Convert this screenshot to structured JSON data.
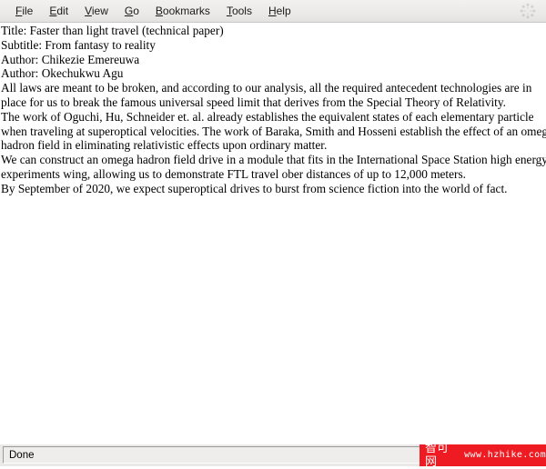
{
  "menubar": {
    "items": [
      {
        "label": "File",
        "mnemonic": "F",
        "rest": "ile"
      },
      {
        "label": "Edit",
        "mnemonic": "E",
        "rest": "dit"
      },
      {
        "label": "View",
        "mnemonic": "V",
        "rest": "iew"
      },
      {
        "label": "Go",
        "mnemonic": "G",
        "rest": "o"
      },
      {
        "label": "Bookmarks",
        "mnemonic": "B",
        "rest": "ookmarks"
      },
      {
        "label": "Tools",
        "mnemonic": "T",
        "rest": "ools"
      },
      {
        "label": "Help",
        "mnemonic": "H",
        "rest": "elp"
      }
    ],
    "throbber_icon": "throbber-icon"
  },
  "document": {
    "title_line": "Title: Faster than light travel (technical paper)",
    "subtitle_line": "Subtitle: From fantasy to reality",
    "author_line_1": "Author: Chikezie Emereuwa",
    "author_line_2": "Author: Okechukwu Agu",
    "paragraphs": [
      {
        "lines": [
          "All laws are meant to be broken, and according to our analysis, all the required antecedent technologies are in",
          "place for us to break the famous universal speed limit that derives from the Special Theory of Relativity."
        ]
      },
      {
        "lines": [
          "The work of Oguchi, Hu, Schneider et. al. already establishes the equivalent states of each elementary particle",
          "when traveling at superoptical velocities. The work of Baraka, Smith and Hosseni establish the effect of an omega",
          "hadron field in eliminating relativistic effects upon ordinary matter."
        ]
      },
      {
        "lines": [
          "We can construct an omega hadron field drive in a module that fits in the International Space Station high energy",
          "experiments wing, allowing us to demonstrate FTL travel ober distances of up to 12,000 meters."
        ]
      },
      {
        "lines": [
          "By September of 2020, we expect superoptical drives to burst from science fiction into the world of fact."
        ]
      }
    ]
  },
  "statusbar": {
    "text": "Done"
  },
  "watermark": {
    "brand": "智可网",
    "url": "www.hzhike.com",
    "color": "#ee1c22"
  }
}
